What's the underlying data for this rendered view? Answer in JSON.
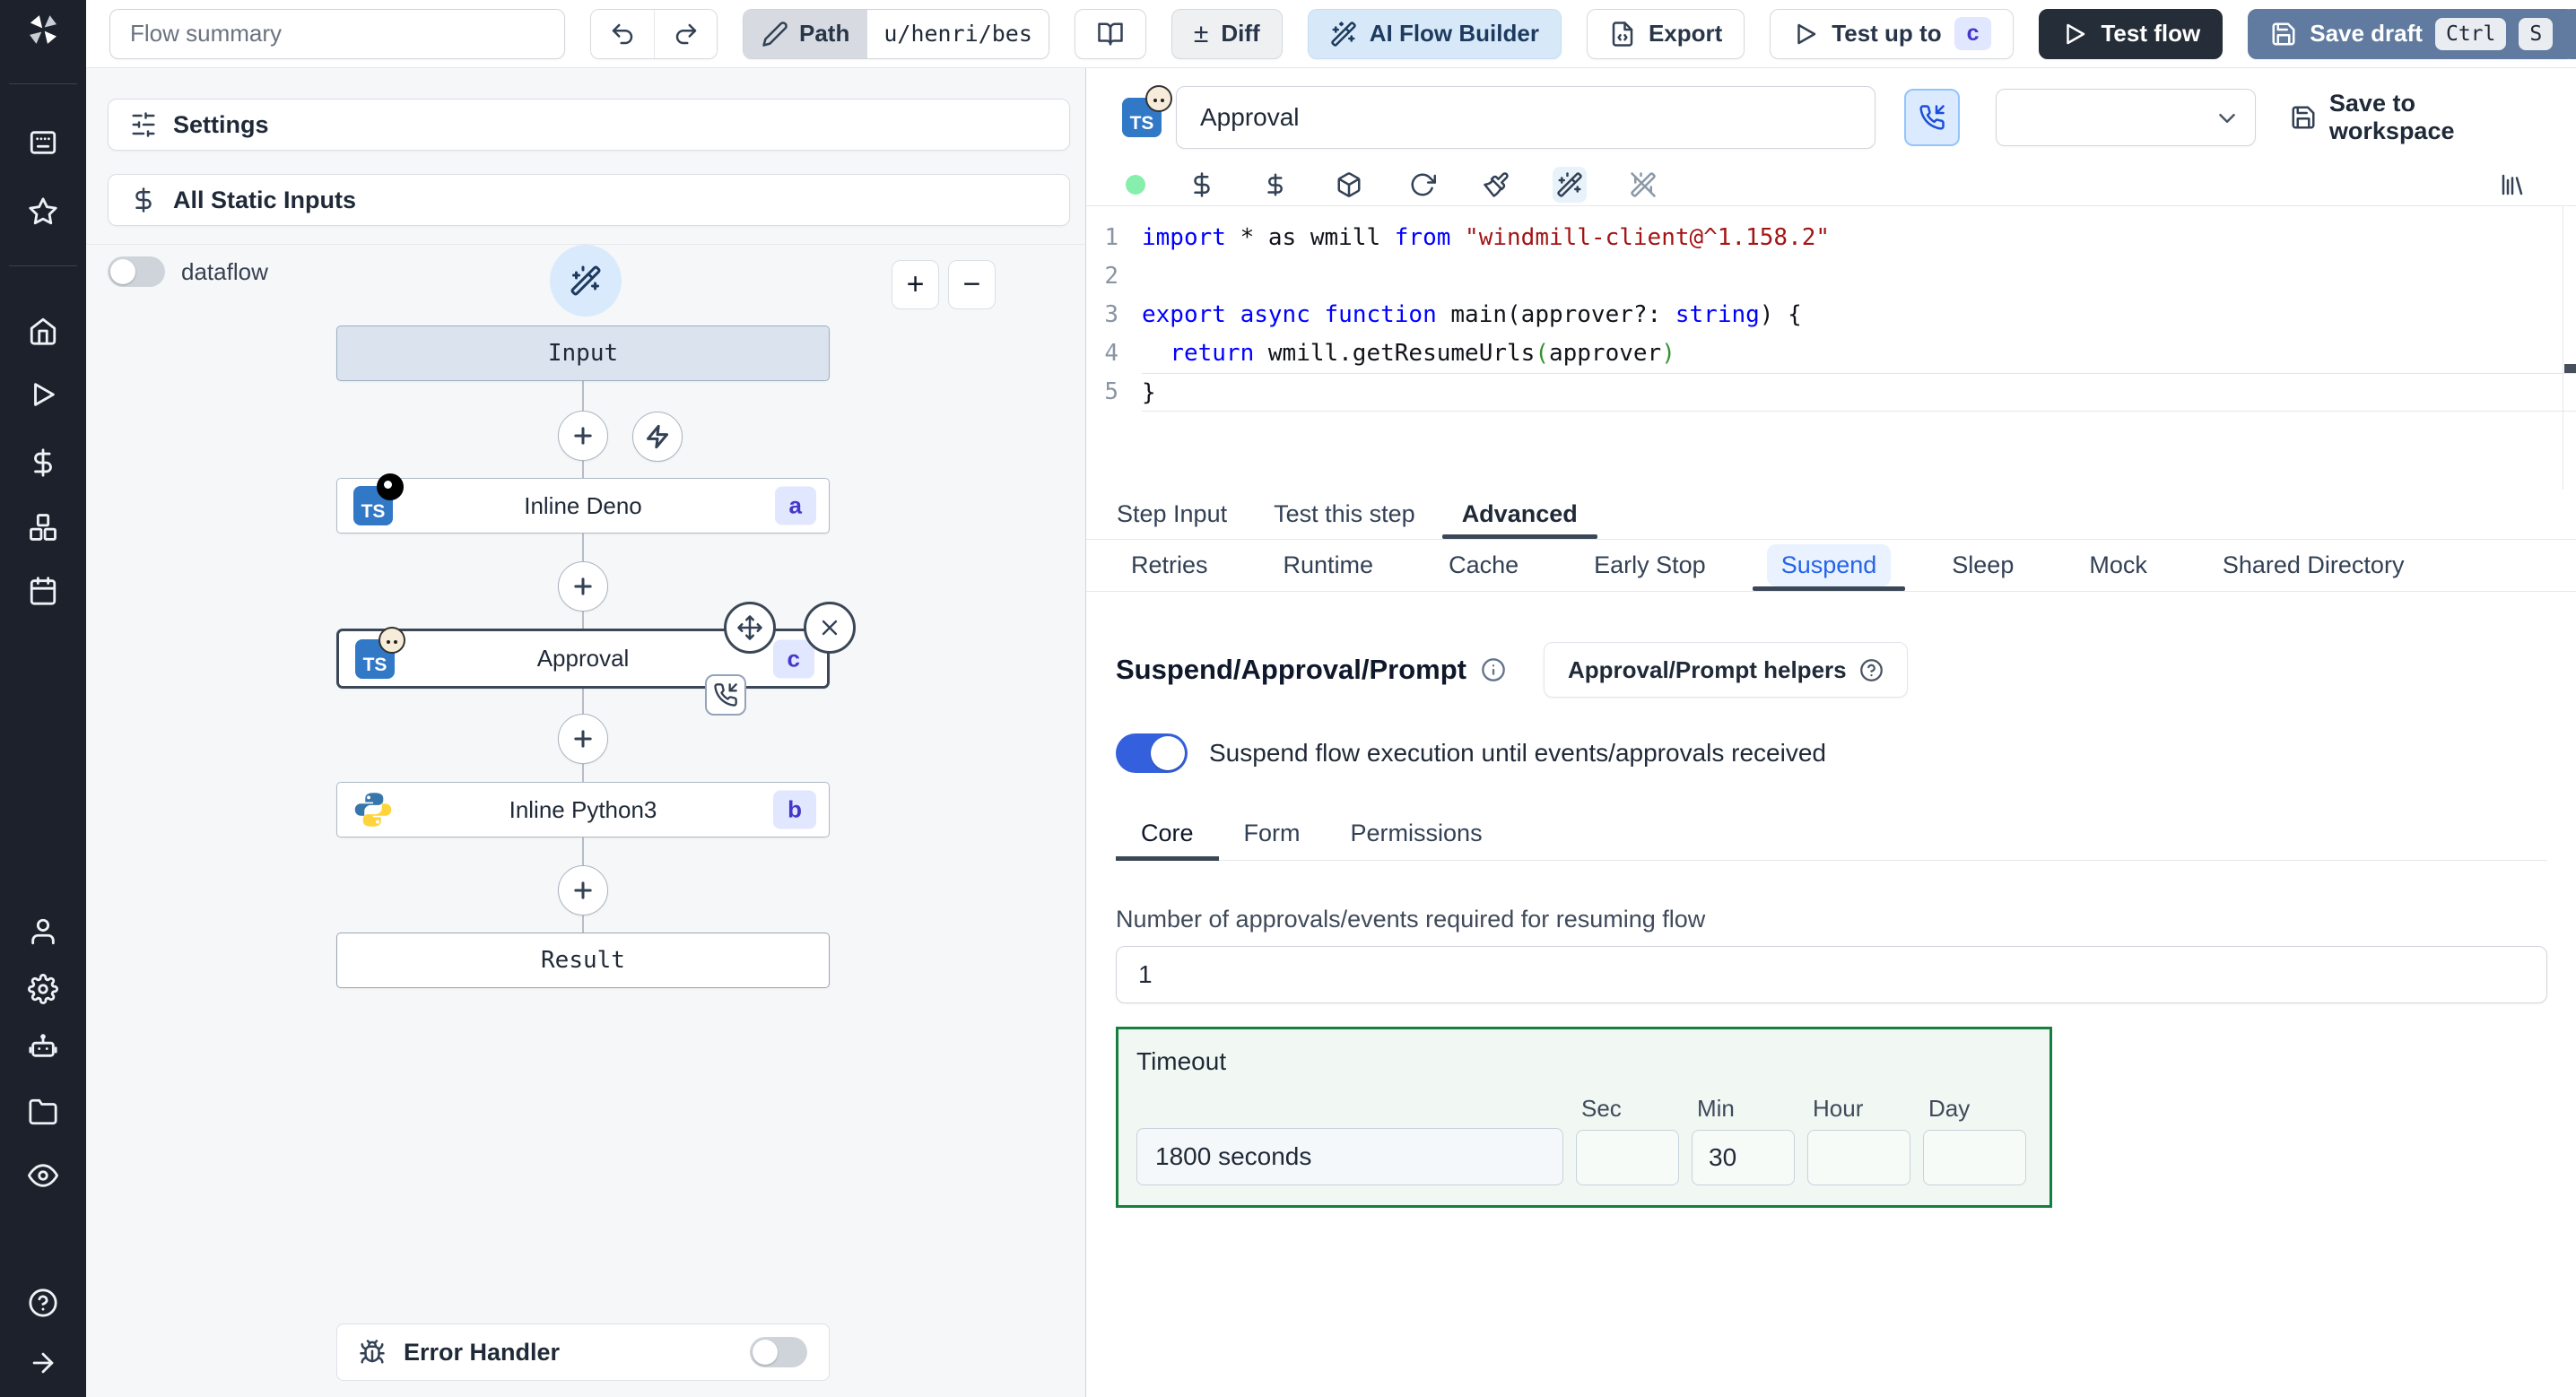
{
  "colors": {
    "sidebar_bg": "#1c212b",
    "panel_bg": "#f6f7f8",
    "accent_blue": "#2563eb",
    "ts_blue": "#3178c6",
    "badge_bg": "#e0e7ff",
    "badge_text": "#4338ca",
    "ai_builder_bg": "#d7e9f9",
    "test_flow_bg": "#252d38",
    "save_draft_bg": "#607b9f",
    "timeout_border": "#15803d",
    "toggle_on": "#3560dd",
    "status_dot": "#86efac",
    "code_keyword": "#0000ff",
    "code_string": "#a31515"
  },
  "topbar": {
    "flow_summary_placeholder": "Flow summary",
    "path_label": "Path",
    "path_value": "u/henri/bes",
    "diff_sign": "±",
    "diff_label": "Diff",
    "ai_flow_builder_label": "AI Flow Builder",
    "export_label": "Export",
    "test_up_to_label": "Test up to",
    "test_up_to_badge": "c",
    "test_flow_label": "Test flow",
    "save_draft_label": "Save draft",
    "save_draft_kbd": [
      "Ctrl",
      "S"
    ]
  },
  "flow_panel": {
    "settings_label": "Settings",
    "static_inputs_label": "All Static Inputs",
    "dataflow_label": "dataflow",
    "zoom_in_label": "+",
    "zoom_out_label": "−",
    "error_handler_label": "Error Handler"
  },
  "graph": {
    "input_label": "Input",
    "result_label": "Result",
    "nodes": [
      {
        "label": "Inline Deno",
        "badge": "a"
      },
      {
        "label": "Approval",
        "badge": "c"
      },
      {
        "label": "Inline Python3",
        "badge": "b"
      }
    ]
  },
  "step": {
    "name_value": "Approval",
    "dropdown_value": "",
    "save_to_workspace_label": "Save to workspace"
  },
  "code": {
    "line_numbers": [
      "1",
      "2",
      "3",
      "4",
      "5"
    ],
    "l1": {
      "k1": "import",
      "p1": " * as wmill ",
      "k2": "from",
      "p2": " ",
      "s1": "\"windmill-client@^1.158.2\""
    },
    "l3": {
      "k1": "export",
      "p1": " ",
      "k2": "async",
      "p2": " ",
      "k3": "function",
      "p3": " main(approver?: ",
      "k4": "string",
      "p4": ") {"
    },
    "l4": {
      "p1": "  ",
      "k1": "return",
      "p2": " wmill.getResumeUrls",
      "b1": "(",
      "p3": "approver",
      "b2": ")"
    },
    "l5": {
      "p1": "}"
    }
  },
  "tabs": {
    "step": [
      "Step Input",
      "Test this step",
      "Advanced"
    ],
    "advanced": [
      "Retries",
      "Runtime",
      "Cache",
      "Early Stop",
      "Suspend",
      "Sleep",
      "Mock",
      "Shared Directory"
    ],
    "suspend_sub": [
      "Core",
      "Form",
      "Permissions"
    ]
  },
  "suspend": {
    "title": "Suspend/Approval/Prompt",
    "helpers_button_label": "Approval/Prompt helpers",
    "toggle_label": "Suspend flow execution until events/approvals received",
    "approvals_label": "Number of approvals/events required for resuming flow",
    "approvals_value": "1",
    "timeout": {
      "label": "Timeout",
      "summary_value": "1800 seconds",
      "units": [
        "Sec",
        "Min",
        "Hour",
        "Day"
      ],
      "values": {
        "sec": "",
        "min": "30",
        "hour": "",
        "day": ""
      }
    }
  }
}
